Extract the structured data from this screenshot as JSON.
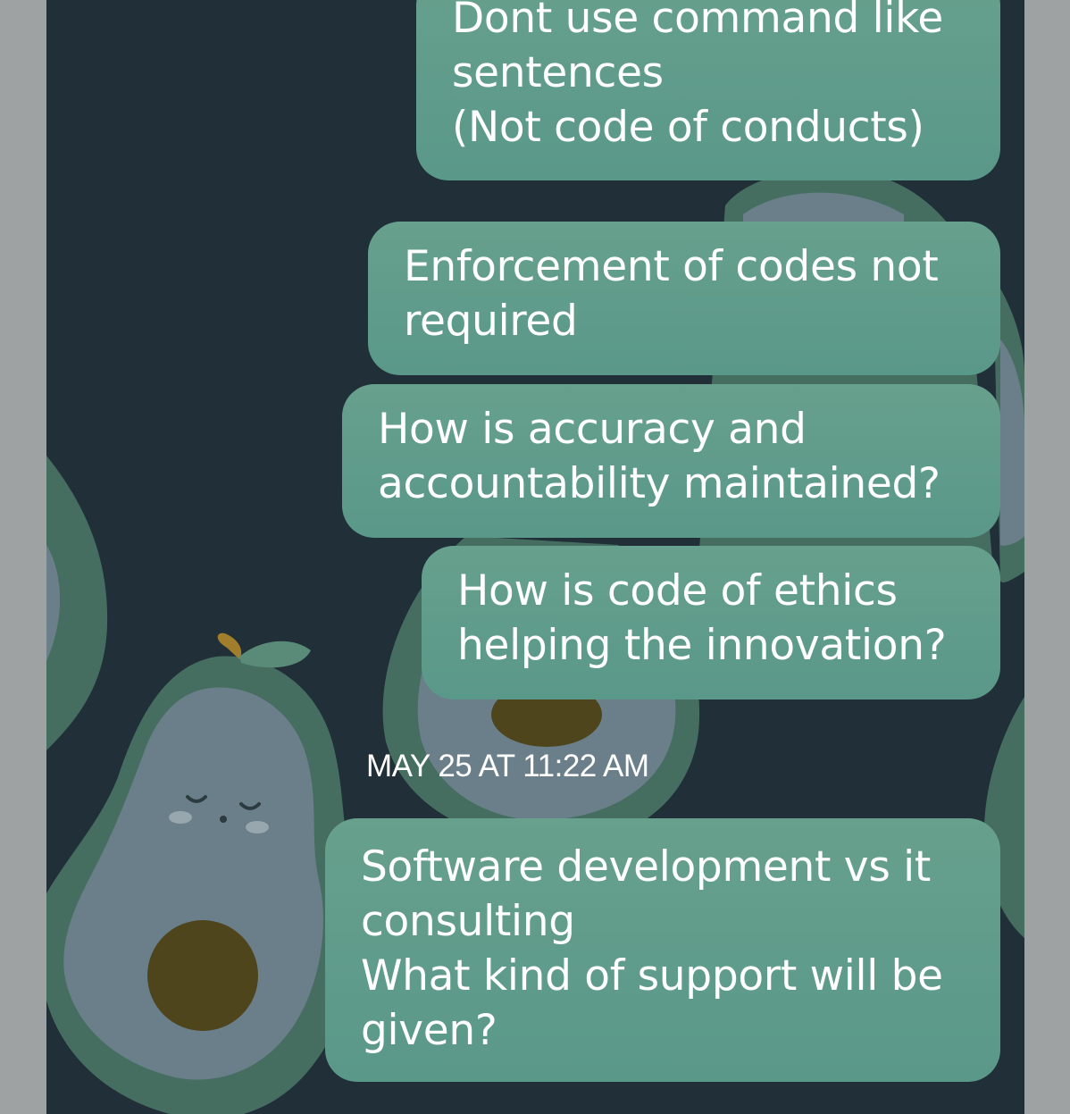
{
  "conversation": {
    "messages": [
      {
        "text": "Dont use command like\nsentences\n(Not code of conducts)"
      },
      {
        "text": "Enforcement of codes not\nrequired"
      },
      {
        "text": "How is accuracy and\naccountability maintained?"
      },
      {
        "text": "How is code of ethics\nhelping the innovation?"
      },
      {
        "text": "Software development vs it\nconsulting\nWhat kind of support will be\ngiven?"
      }
    ],
    "timestamp": "MAY 25 AT 11:22 AM"
  },
  "wallpaper": {
    "icon": "avocado-icon",
    "colors": {
      "background": "#202f38",
      "skin": "#466e60",
      "flesh": "#6a7f8a",
      "pit": "#4e451c",
      "leaf": "#5a8a78"
    }
  },
  "colors": {
    "bubble": "#609a88",
    "text": "#ffffff"
  }
}
